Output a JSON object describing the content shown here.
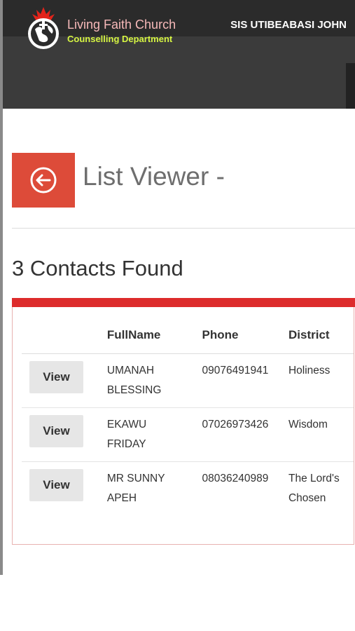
{
  "header": {
    "brand_title": "Living Faith Church",
    "brand_subtitle": "Counselling Department",
    "user_name": "SIS UTIBEABASI JOHN"
  },
  "page": {
    "title": "List Viewer -",
    "result_count_text": "3 Contacts Found"
  },
  "table": {
    "columns": [
      "",
      "FullName",
      "Phone",
      "District"
    ],
    "view_label": "View",
    "rows": [
      {
        "full_name": "UMANAH BLESSING",
        "phone": "09076491941",
        "district": "Holiness"
      },
      {
        "full_name": "EKAWU FRIDAY",
        "phone": "07026973426",
        "district": "Wisdom"
      },
      {
        "full_name": "MR SUNNY APEH",
        "phone": "08036240989",
        "district": "The Lord's Chosen"
      }
    ]
  },
  "colors": {
    "accent_red": "#dd4b39",
    "panel_top": "#dd2c2c",
    "header_bg": "#3b3b3b",
    "brand_title": "#f7b9b9",
    "brand_subtitle": "#d6f542"
  }
}
